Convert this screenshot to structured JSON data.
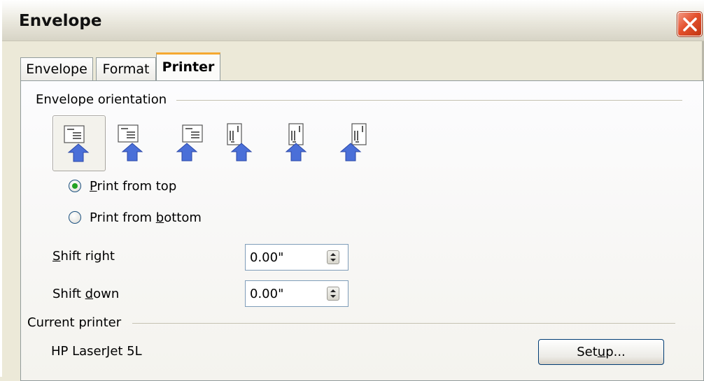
{
  "window": {
    "title": "Envelope",
    "close_icon": "close-x-icon"
  },
  "tabs": [
    {
      "label": "Envelope",
      "active": false
    },
    {
      "label": "Format",
      "active": false
    },
    {
      "label": "Printer",
      "active": true
    }
  ],
  "orientation": {
    "section_label": "Envelope orientation",
    "options": [
      {
        "icon": "envelope-landscape-up-icon",
        "selected": true
      },
      {
        "icon": "envelope-landscape-center-icon",
        "selected": false
      },
      {
        "icon": "envelope-landscape-right-icon",
        "selected": false
      },
      {
        "icon": "envelope-portrait-left-icon",
        "selected": false
      },
      {
        "icon": "envelope-portrait-center-icon",
        "selected": false
      },
      {
        "icon": "envelope-portrait-right-icon",
        "selected": false
      }
    ],
    "print_from_top": {
      "label_pre": "",
      "label_key": "P",
      "label_post": "rint from top",
      "checked": true
    },
    "print_from_bottom": {
      "label_pre": "Print from ",
      "label_key": "b",
      "label_post": "ottom",
      "checked": false
    }
  },
  "shift": {
    "right": {
      "label_key": "S",
      "label_post": "hift right",
      "value": "0.00\""
    },
    "down": {
      "label_pre": "Shift ",
      "label_key": "d",
      "label_post": "own",
      "value": "0.00\""
    }
  },
  "printer": {
    "section_label": "Current printer",
    "name": "HP LaserJet 5L",
    "setup_pre": "Set",
    "setup_key": "u",
    "setup_post": "p..."
  },
  "colors": {
    "accent_tab": "#f5a830",
    "radio_checked": "#21a121",
    "arrow": "#4a6fd8",
    "close": "#e4512e"
  }
}
